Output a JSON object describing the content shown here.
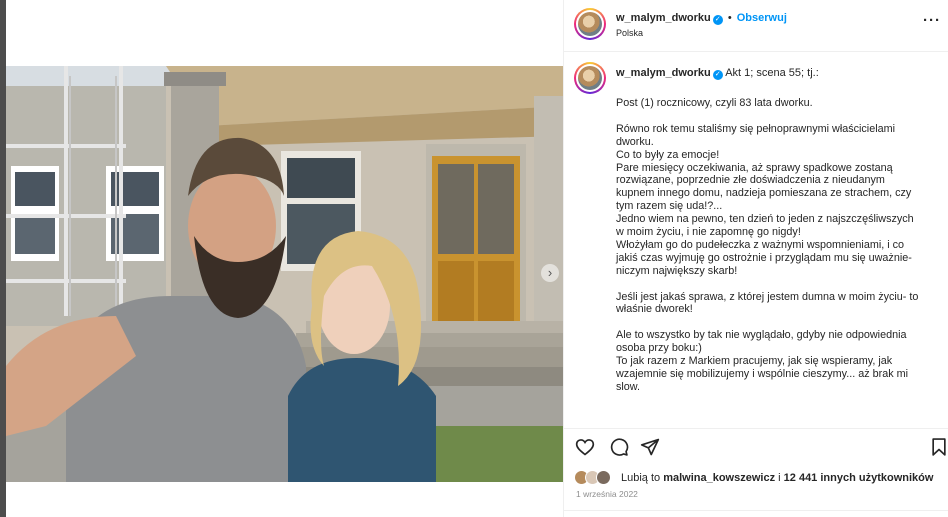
{
  "post": {
    "username": "w_malym_dworku",
    "separator": "•",
    "follow_label": "Obserwuj",
    "location": "Polska",
    "more_label": "···",
    "carousel_next": "›"
  },
  "caption": {
    "username": "w_malym_dworku",
    "intro": "Akt 1; scena 55; tj.:",
    "lines": [
      "Post (1) rocznicowy, czyli 83 lata dworku.",
      "",
      "Równo rok temu staliśmy się pełnoprawnymi właścicielami",
      "dworku.",
      "Co to były za emocje!",
      "Pare miesięcy oczekiwania, aż sprawy spadkowe zostaną",
      "rozwiązane, poprzednie złe doświadczenia z nieudanym",
      "kupnem innego domu, nadzieja pomieszana ze strachem, czy",
      "tym razem się uda!?...",
      "Jedno wiem na pewno, ten dzień to jeden z najszczęśliwszych",
      "w moim życiu, i nie zapomnę go nigdy!",
      "Włożyłam go do pudełeczka z ważnymi wspomnieniami, i co",
      "jakiś czas wyjmuję go ostrożnie i przyglądam mu się uważnie-",
      "niczym największy skarb!",
      "",
      "Jeśli jest jakaś sprawa, z której jestem dumna w moim życiu- to",
      "właśnie dworek!",
      "",
      "Ale to wszystko by tak nie wyglądało, gdyby nie odpowiednia",
      "osoba przy boku:)",
      "To jak razem z Markiem pracujemy, jak się wspieramy, jak",
      "wzajemnie się mobilizujemy i wspólnie cieszymy... aż brak mi",
      "slow."
    ]
  },
  "likes": {
    "prefix": "Lubią to ",
    "user": "malwina_kowszewicz",
    "middle": " i ",
    "count": "12 441 innych użytkowników"
  },
  "date": "1 września 2022",
  "icons": {
    "like": "heart-icon",
    "comment": "comment-icon",
    "share": "paper-plane-icon",
    "save": "bookmark-icon",
    "verified": "verified-badge-icon"
  },
  "colors": {
    "accent": "#0095f6",
    "text": "#262626",
    "muted": "#8e8e8e",
    "divider": "#efefef"
  }
}
